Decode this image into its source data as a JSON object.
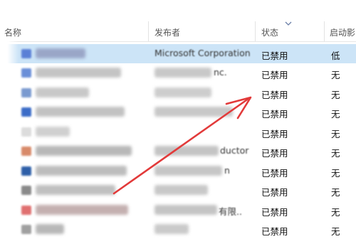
{
  "columns": {
    "name": "名称",
    "publisher": "发布者",
    "status": "状态",
    "impact": "启动影"
  },
  "rows": [
    {
      "publisher_visible": "Microsoft Corporation",
      "status": "已禁用",
      "impact": "低",
      "selected": true,
      "icon_color": "#5b7fd6"
    },
    {
      "publisher_visible": "nc.",
      "status": "已禁用",
      "impact": "无",
      "icon_color": "#6a8fd8"
    },
    {
      "publisher_visible": "",
      "status": "已禁用",
      "impact": "无",
      "icon_color": "#7a9ad0"
    },
    {
      "publisher_visible": "",
      "status": "已禁用",
      "impact": "无",
      "icon_color": "#3b6cc7"
    },
    {
      "publisher_visible": "",
      "status": "已禁用",
      "impact": "无",
      "icon_color": "#dcdcdc"
    },
    {
      "publisher_visible": "ductor",
      "status": "已禁用",
      "impact": "无",
      "icon_color": "#d88a6a"
    },
    {
      "publisher_visible": "n",
      "status": "已禁用",
      "impact": "无",
      "icon_color": "#2e5fa8"
    },
    {
      "publisher_visible": "",
      "status": "已禁用",
      "impact": "无",
      "icon_color": "#8a8a8a"
    },
    {
      "publisher_visible": "有限..",
      "status": "已禁用",
      "impact": "无",
      "icon_color": "#e07070"
    },
    {
      "publisher_visible": "",
      "status": "已禁用",
      "impact": "无",
      "icon_color": "#a0a0a0"
    }
  ],
  "colors": {
    "selected_row": "#cce4f7",
    "annotation_arrow": "#e23a3a"
  }
}
